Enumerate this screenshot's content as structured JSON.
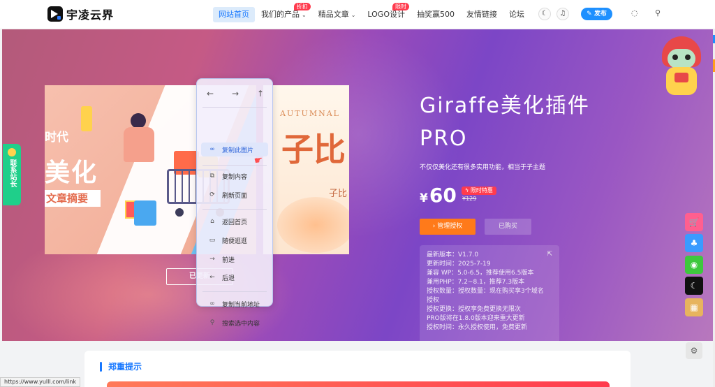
{
  "header": {
    "logo_text": "宇凌云界",
    "nav": [
      {
        "label": "网站首页",
        "active": true
      },
      {
        "label": "我们的产品",
        "badge": "折扣",
        "caret": true
      },
      {
        "label": "精品文章",
        "caret": true
      },
      {
        "label": "LOGO设计",
        "badge": "限时"
      },
      {
        "label": "抽奖赢500"
      },
      {
        "label": "友情链接"
      },
      {
        "label": "论坛"
      }
    ],
    "publish_label": "发布",
    "icons": [
      "moon-icon",
      "bell-icon",
      "pencil-icon",
      "bulb-icon",
      "search-icon"
    ]
  },
  "hero": {
    "card_main": {
      "line1": "时代",
      "line2": "美化",
      "line3": "文章摘要"
    },
    "card_second": {
      "autumn": "AUTUMNAL",
      "big": "子比",
      "small": "子比"
    },
    "updated_label": "已更新",
    "context_menu": {
      "arrows": [
        "←",
        "→",
        "↑"
      ],
      "items": [
        {
          "label": "复制此图片",
          "icon": "link-icon",
          "highlighted": true
        },
        {
          "label": "复制内容",
          "icon": "copy-icon"
        },
        {
          "label": "刷新页面",
          "icon": "refresh-icon"
        },
        {
          "label": "返回首页",
          "icon": "home-icon"
        },
        {
          "label": "随便逛逛",
          "icon": "gamepad-icon"
        },
        {
          "label": "前进",
          "icon": "arrow-right-icon"
        },
        {
          "label": "后退",
          "icon": "arrow-left-icon"
        },
        {
          "label": "复制当前地址",
          "icon": "link-icon"
        },
        {
          "label": "搜索选中内容",
          "icon": "search-icon"
        }
      ]
    }
  },
  "product": {
    "title": "Giraffe美化插件PRO",
    "subtitle": "不仅仅美化还有很多实用功能，相当于子主题",
    "currency": "¥",
    "price": "60",
    "badge": "限时特惠",
    "original_price": "¥129",
    "manage_button": "› 管理授权",
    "bought_button": "已购买",
    "info": [
      "最新版本：V1.7.0",
      "更新时间：2025-7-19",
      "兼容 WP：5.0-6.5，推荐使用6.5版本",
      "兼用PHP：7.2~8.1，推荐7.3版本",
      "授权数量：授权数量：现在购买享3个域名",
      "授权",
      "授权更换：授权享免费更换无限次",
      "PRO版将在1.8.0版本迎来重大更新",
      "授权时间：永久授权使用，免费更新"
    ]
  },
  "sidebar_contact": "联系站长",
  "float_buttons": [
    {
      "name": "cart-icon",
      "color": "#ff5f8f"
    },
    {
      "name": "qq-icon",
      "color": "#3a9bff"
    },
    {
      "name": "wechat-icon",
      "color": "#3ec83e"
    },
    {
      "name": "moon-icon",
      "color": "#111111"
    },
    {
      "name": "qrcode-icon",
      "color": "#e7b45e"
    }
  ],
  "notice": {
    "title": "郑重提示"
  },
  "status_url": "https://www.yulll.com/link"
}
